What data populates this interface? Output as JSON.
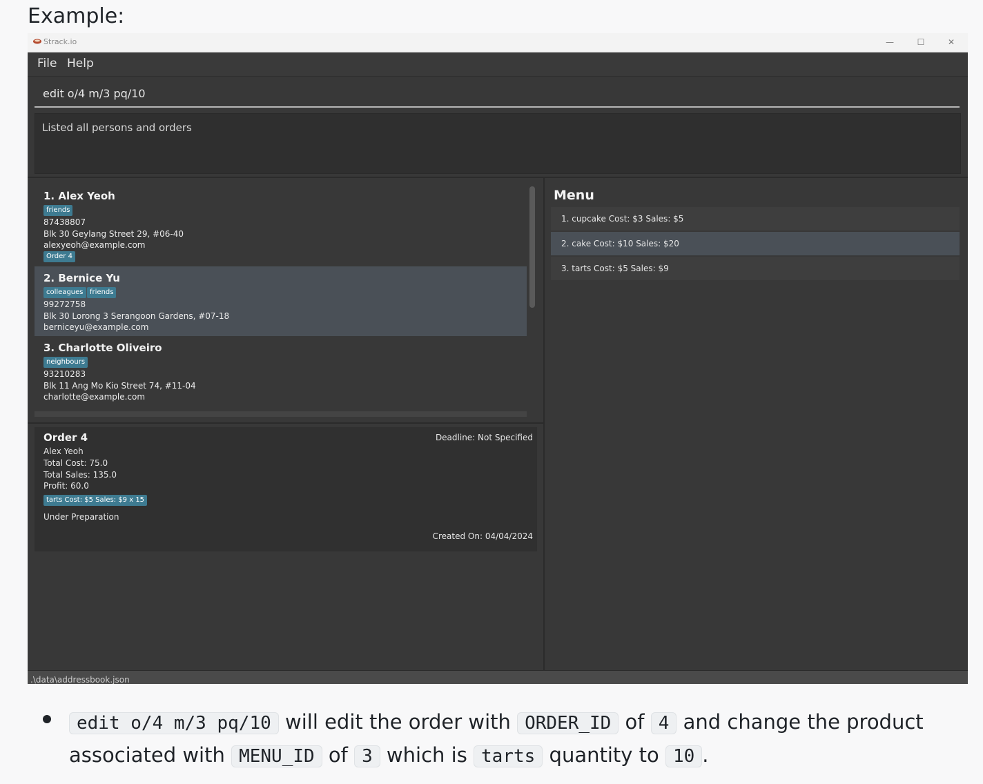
{
  "heading": "Example:",
  "window": {
    "title": "Strack.io",
    "minimize": "—",
    "maximize": "☐",
    "close": "✕"
  },
  "menubar": {
    "file": "File",
    "help": "Help"
  },
  "command": {
    "value": "edit o/4 m/3 pq/10"
  },
  "result": {
    "text": "Listed all persons and orders"
  },
  "persons": [
    {
      "name": "1.  Alex Yeoh",
      "tags": [
        "friends"
      ],
      "phone": "87438807",
      "address": "Blk 30 Geylang Street 29, #06-40",
      "email": "alexyeoh@example.com",
      "order_tag": "Order 4"
    },
    {
      "name": "2.  Bernice Yu",
      "tags": [
        "colleagues",
        "friends"
      ],
      "phone": "99272758",
      "address": "Blk 30 Lorong 3 Serangoon Gardens, #07-18",
      "email": "berniceyu@example.com"
    },
    {
      "name": "3.  Charlotte Oliveiro",
      "tags": [
        "neighbours"
      ],
      "phone": "93210283",
      "address": "Blk 11 Ang Mo Kio Street 74, #11-04",
      "email": "charlotte@example.com"
    }
  ],
  "order": {
    "title": "Order 4",
    "deadline": "Deadline: Not Specified",
    "customer": "Alex Yeoh",
    "total_cost": "Total Cost: 75.0",
    "total_sales": "Total Sales: 135.0",
    "profit": "Profit: 60.0",
    "product_tag": "tarts Cost: $5 Sales: $9 x 15",
    "status": "Under Preparation",
    "created": "Created On: 04/04/2024"
  },
  "menu": {
    "title": "Menu",
    "items": [
      "1. cupcake  Cost: $3  Sales: $5",
      "2. cake  Cost: $10  Sales: $20",
      "3. tarts  Cost: $5  Sales: $9"
    ],
    "selected_index": 1
  },
  "status_bar": {
    "path": ".\\data\\addressbook.json"
  },
  "explanation": {
    "cmd": "edit o/4 m/3 pq/10",
    "t1": " will edit the order with ",
    "c2": "ORDER_ID",
    "t2": " of ",
    "c3": "4",
    "t3": " and change the product",
    "t4": "associated with ",
    "c4": "MENU_ID",
    "t5": " of ",
    "c5": "3",
    "t6": " which is ",
    "c6": "tarts",
    "t7": " quantity to ",
    "c7": "10",
    "t8": "."
  },
  "colors": {
    "app_bg": "#383838",
    "tag_bg": "#3e7b91",
    "selected_bg": "#4a5057"
  }
}
